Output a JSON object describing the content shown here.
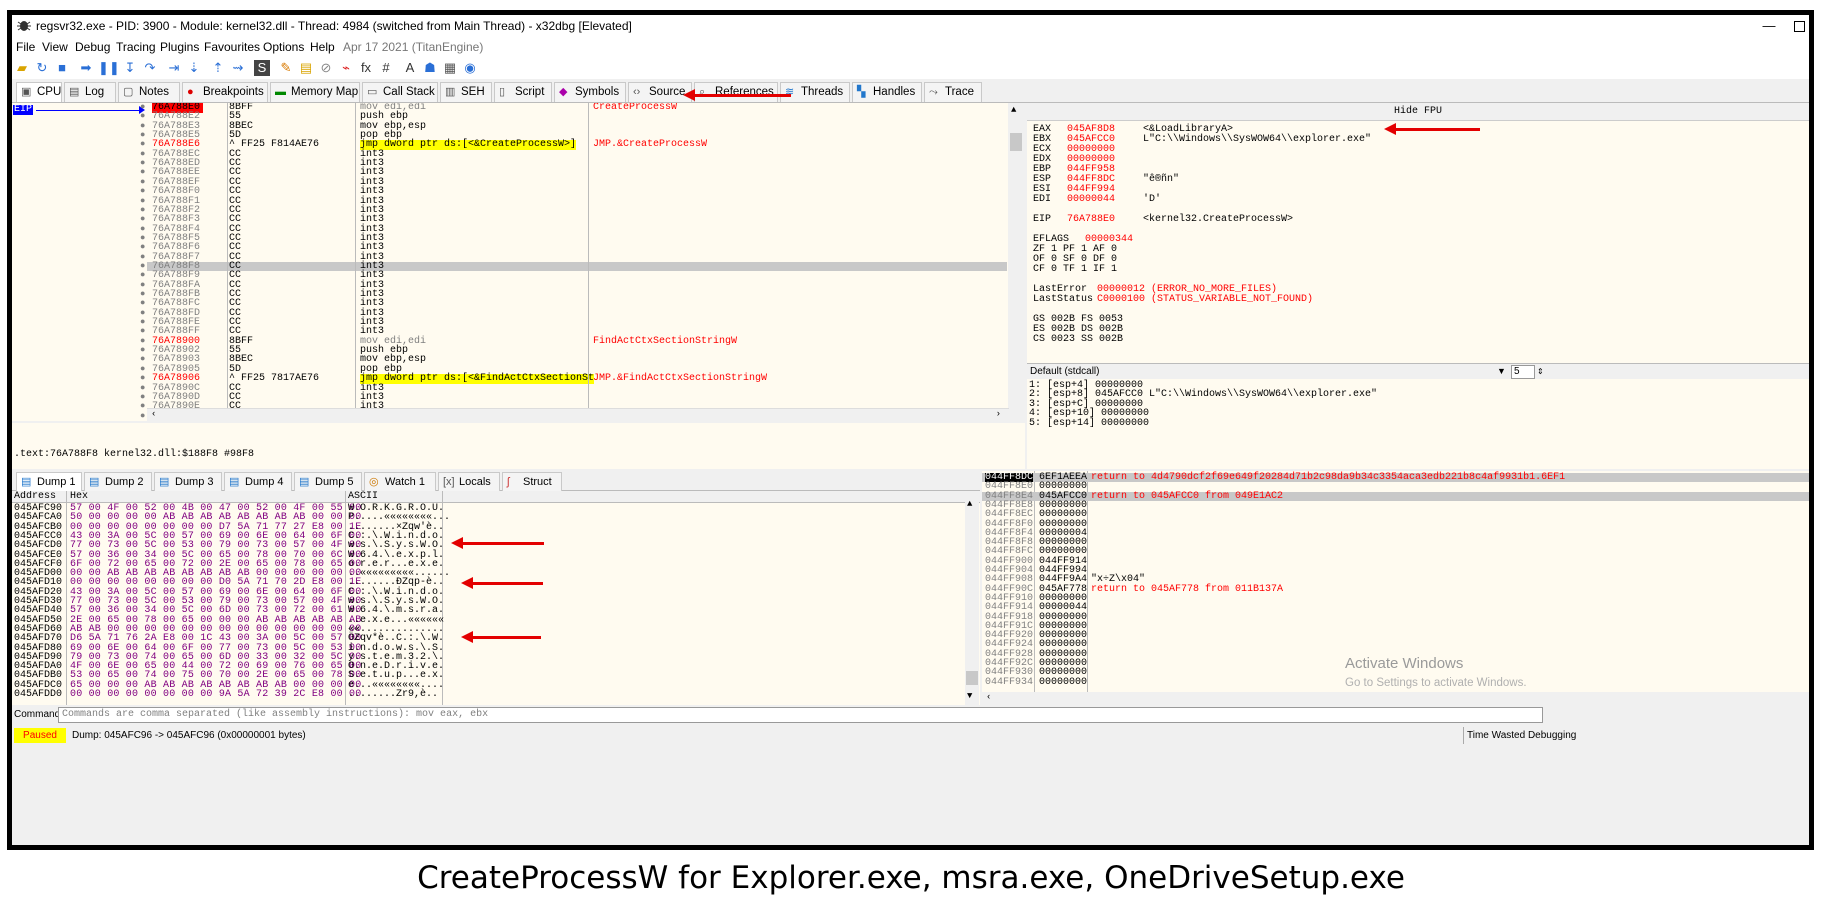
{
  "window": {
    "title": "regsvr32.exe - PID: 3900 - Module: kernel32.dll - Thread: 4984 (switched from Main Thread) - x32dbg [Elevated]",
    "minimize": "—"
  },
  "menu": [
    "File",
    "View",
    "Debug",
    "Tracing",
    "Plugins",
    "Favourites",
    "Options",
    "Help"
  ],
  "build_date": "Apr 17 2021 (TitanEngine)",
  "tabs": [
    "CPU",
    "Log",
    "Notes",
    "Breakpoints",
    "Memory Map",
    "Call Stack",
    "SEH",
    "Script",
    "Symbols",
    "Source",
    "References",
    "Threads",
    "Handles",
    "Trace"
  ],
  "disasm": {
    "eip_label": "EIP",
    "rows": [
      {
        "addr": "76A788E0",
        "bytes": "8BFF",
        "dis": "mov edi,edi",
        "cmt": "CreateProcessW",
        "addr_style": "hl",
        "dis_style": "gray"
      },
      {
        "addr": "76A788E2",
        "bytes": "55",
        "dis": "push ebp",
        "cmt": ""
      },
      {
        "addr": "76A788E3",
        "bytes": "8BEC",
        "dis": "mov ebp,esp",
        "cmt": ""
      },
      {
        "addr": "76A788E5",
        "bytes": "5D",
        "dis": "pop ebp",
        "cmt": ""
      },
      {
        "addr": "76A788E6",
        "bytes": "^ FF25 F814AE76",
        "dis": "jmp dword ptr ds:[<&CreateProcessW>]",
        "cmt": "JMP.&CreateProcessW",
        "addr_style": "red"
      },
      {
        "addr": "76A788EC",
        "bytes": "CC",
        "dis": "int3",
        "cmt": ""
      },
      {
        "addr": "76A788ED",
        "bytes": "CC",
        "dis": "int3",
        "cmt": ""
      },
      {
        "addr": "76A788EE",
        "bytes": "CC",
        "dis": "int3",
        "cmt": ""
      },
      {
        "addr": "76A788EF",
        "bytes": "CC",
        "dis": "int3",
        "cmt": ""
      },
      {
        "addr": "76A788F0",
        "bytes": "CC",
        "dis": "int3",
        "cmt": ""
      },
      {
        "addr": "76A788F1",
        "bytes": "CC",
        "dis": "int3",
        "cmt": ""
      },
      {
        "addr": "76A788F2",
        "bytes": "CC",
        "dis": "int3",
        "cmt": ""
      },
      {
        "addr": "76A788F3",
        "bytes": "CC",
        "dis": "int3",
        "cmt": ""
      },
      {
        "addr": "76A788F4",
        "bytes": "CC",
        "dis": "int3",
        "cmt": ""
      },
      {
        "addr": "76A788F5",
        "bytes": "CC",
        "dis": "int3",
        "cmt": ""
      },
      {
        "addr": "76A788F6",
        "bytes": "CC",
        "dis": "int3",
        "cmt": ""
      },
      {
        "addr": "76A788F7",
        "bytes": "CC",
        "dis": "int3",
        "cmt": ""
      },
      {
        "addr": "76A788F8",
        "bytes": "CC",
        "dis": "int3",
        "cmt": "",
        "sel": true
      },
      {
        "addr": "76A788F9",
        "bytes": "CC",
        "dis": "int3",
        "cmt": ""
      },
      {
        "addr": "76A788FA",
        "bytes": "CC",
        "dis": "int3",
        "cmt": ""
      },
      {
        "addr": "76A788FB",
        "bytes": "CC",
        "dis": "int3",
        "cmt": ""
      },
      {
        "addr": "76A788FC",
        "bytes": "CC",
        "dis": "int3",
        "cmt": ""
      },
      {
        "addr": "76A788FD",
        "bytes": "CC",
        "dis": "int3",
        "cmt": ""
      },
      {
        "addr": "76A788FE",
        "bytes": "CC",
        "dis": "int3",
        "cmt": ""
      },
      {
        "addr": "76A788FF",
        "bytes": "CC",
        "dis": "int3",
        "cmt": ""
      },
      {
        "addr": "76A78900",
        "bytes": "8BFF",
        "dis": "mov edi,edi",
        "cmt": "FindActCtxSectionStringW",
        "addr_style": "red",
        "dis_style": "gray"
      },
      {
        "addr": "76A78902",
        "bytes": "55",
        "dis": "push ebp",
        "cmt": ""
      },
      {
        "addr": "76A78903",
        "bytes": "8BEC",
        "dis": "mov ebp,esp",
        "cmt": ""
      },
      {
        "addr": "76A78905",
        "bytes": "5D",
        "dis": "pop ebp",
        "cmt": ""
      },
      {
        "addr": "76A78906",
        "bytes": "^ FF25 7817AE76",
        "dis": "jmp dword ptr ds:[<&FindActCtxSectionSt",
        "cmt": "JMP.&FindActCtxSectionStringW",
        "addr_style": "red"
      },
      {
        "addr": "76A7890C",
        "bytes": "CC",
        "dis": "int3",
        "cmt": ""
      },
      {
        "addr": "76A7890D",
        "bytes": "CC",
        "dis": "int3",
        "cmt": ""
      },
      {
        "addr": "76A7890E",
        "bytes": "CC",
        "dis": "int3",
        "cmt": ""
      },
      {
        "addr": "76A7890F",
        "bytes": "CC",
        "dis": "int3",
        "cmt": ""
      }
    ]
  },
  "info_line": ".text:76A788F8 kernel32.dll:$188F8 #98F8",
  "registers": {
    "hide_fpu": "Hide FPU",
    "regs": [
      {
        "n": "EAX",
        "v": "045AF8D8",
        "c": "<&LoadLibraryA>"
      },
      {
        "n": "EBX",
        "v": "045AFCC0",
        "c": "L\"C:\\\\Windows\\\\SysWOW64\\\\explorer.exe\""
      },
      {
        "n": "ECX",
        "v": "00000000",
        "c": ""
      },
      {
        "n": "EDX",
        "v": "00000000",
        "c": ""
      },
      {
        "n": "EBP",
        "v": "044FF958",
        "c": ""
      },
      {
        "n": "ESP",
        "v": "044FF8DC",
        "c": "\"ê®ñn\""
      },
      {
        "n": "ESI",
        "v": "044FF994",
        "c": ""
      },
      {
        "n": "EDI",
        "v": "00000044",
        "c": "'D'"
      }
    ],
    "eip": {
      "n": "EIP",
      "v": "76A788E0",
      "c": "<kernel32.CreateProcessW>"
    },
    "eflags": {
      "n": "EFLAGS",
      "v": "00000344"
    },
    "flag_rows": [
      "ZF 1  PF 1  AF 0",
      "OF 0  SF 0  DF 0",
      "CF 0  TF 1  IF 1"
    ],
    "lasterror": {
      "n": "LastError",
      "v": "00000012",
      "c": "(ERROR_NO_MORE_FILES)"
    },
    "laststatus": {
      "n": "LastStatus",
      "v": "C0000100",
      "c": "(STATUS_VARIABLE_NOT_FOUND)"
    },
    "seg_rows": [
      "GS 002B  FS 0053",
      "ES 002B  DS 002B",
      "CS 0023  SS 002B"
    ]
  },
  "callconv": {
    "label": "Default (stdcall)",
    "count": "5"
  },
  "stack_args": [
    "1: [esp+4] 00000000",
    "2: [esp+8] 045AFCC0 L\"C:\\\\Windows\\\\SysWOW64\\\\explorer.exe\"",
    "3: [esp+C] 00000000",
    "4: [esp+10] 00000000",
    "5: [esp+14] 00000000"
  ],
  "dump_tabs": [
    "Dump 1",
    "Dump 2",
    "Dump 3",
    "Dump 4",
    "Dump 5",
    "Watch 1",
    "Locals",
    "Struct"
  ],
  "dump_headers": {
    "address": "Address",
    "hex": "Hex",
    "ascii": "ASCII"
  },
  "dump_rows": [
    {
      "a": "045AFC90",
      "h": "57 00 4F 00 52 00 4B 00 47 00 52 00 4F 00 55 00",
      "s": "W.O.R.K.G.R.O.U."
    },
    {
      "a": "045AFCA0",
      "h": "50 00 00 00 00 AB AB AB AB AB AB AB AB 00 00 00",
      "s": "P.....««««««««..."
    },
    {
      "a": "045AFCB0",
      "h": "00 00 00 00 00 00 00 00 D7 5A 71 77 27 E8 00 1E",
      "s": "........×Zqw'è.."
    },
    {
      "a": "045AFCC0",
      "h": "43 00 3A 00 5C 00 57 00 69 00 6E 00 64 00 6F 00",
      "s": "C.:.\\.W.i.n.d.o."
    },
    {
      "a": "045AFCD0",
      "h": "77 00 73 00 5C 00 53 00 79 00 73 00 57 00 4F 00",
      "s": "w.s.\\.S.y.s.W.O."
    },
    {
      "a": "045AFCE0",
      "h": "57 00 36 00 34 00 5C 00 65 00 78 00 70 00 6C 00",
      "s": "W.6.4.\\.e.x.p.l."
    },
    {
      "a": "045AFCF0",
      "h": "6F 00 72 00 65 00 72 00 2E 00 65 00 78 00 65 00",
      "s": "o.r.e.r...e.x.e."
    },
    {
      "a": "045AFD00",
      "h": "00 00 AB AB AB AB AB AB AB AB 00 00 00 00 00 00",
      "s": "..«««««««««......"
    },
    {
      "a": "045AFD10",
      "h": "00 00 00 00 00 00 00 00 D0 5A 71 70 2D E8 00 1E",
      "s": "........ÐZqp-è.."
    },
    {
      "a": "045AFD20",
      "h": "43 00 3A 00 5C 00 57 00 69 00 6E 00 64 00 6F 00",
      "s": "C.:.\\.W.i.n.d.o."
    },
    {
      "a": "045AFD30",
      "h": "77 00 73 00 5C 00 53 00 79 00 73 00 57 00 4F 00",
      "s": "w.s.\\.S.y.s.W.O."
    },
    {
      "a": "045AFD40",
      "h": "57 00 36 00 34 00 5C 00 6D 00 73 00 72 00 61 00",
      "s": "W.6.4.\\.m.s.r.a."
    },
    {
      "a": "045AFD50",
      "h": "2E 00 65 00 78 00 65 00 00 00 AB AB AB AB AB AB",
      "s": "..e.x.e...««««««"
    },
    {
      "a": "045AFD60",
      "h": "AB AB 00 00 00 00 00 00 00 00 00 00 00 00 00 00",
      "s": "««.............."
    },
    {
      "a": "045AFD70",
      "h": "D6 5A 71 76 2A E8 00 1C 43 00 3A 00 5C 00 57 00",
      "s": "ÖZqv*è..C.:.\\.W."
    },
    {
      "a": "045AFD80",
      "h": "69 00 6E 00 64 00 6F 00 77 00 73 00 5C 00 53 00",
      "s": "i.n.d.o.w.s.\\.S."
    },
    {
      "a": "045AFD90",
      "h": "79 00 73 00 74 00 65 00 6D 00 33 00 32 00 5C 00",
      "s": "y.s.t.e.m.3.2.\\."
    },
    {
      "a": "045AFDA0",
      "h": "4F 00 6E 00 65 00 44 00 72 00 69 00 76 00 65 00",
      "s": "O.n.e.D.r.i.v.e."
    },
    {
      "a": "045AFDB0",
      "h": "53 00 65 00 74 00 75 00 70 00 2E 00 65 00 78 00",
      "s": "S.e.t.u.p...e.x."
    },
    {
      "a": "045AFDC0",
      "h": "65 00 00 00 AB AB AB AB AB AB AB AB 00 00 00 00",
      "s": "e...««««««««...."
    },
    {
      "a": "045AFDD0",
      "h": "00 00 00 00 00 00 00 00 9A 5A 72 39 2C E8 00 00",
      "s": "........Zr9,è.."
    }
  ],
  "stack": [
    {
      "a": "044FF8DC",
      "v": "6EF1AEEA",
      "c": "return to 4d4790dcf2f69e649f20284d71b2c98da9b34c3354aca3edb221b8c4af9931b1.6EF1",
      "sel": true
    },
    {
      "a": "044FF8E0",
      "v": "00000000",
      "c": ""
    },
    {
      "a": "044FF8E4",
      "v": "045AFCC0",
      "c": "return to 045AFCC0 from 049E1AC2",
      "sel": true
    },
    {
      "a": "044FF8E8",
      "v": "00000000",
      "c": ""
    },
    {
      "a": "044FF8EC",
      "v": "00000000",
      "c": ""
    },
    {
      "a": "044FF8F0",
      "v": "00000000",
      "c": ""
    },
    {
      "a": "044FF8F4",
      "v": "00000004",
      "c": ""
    },
    {
      "a": "044FF8F8",
      "v": "00000000",
      "c": ""
    },
    {
      "a": "044FF8FC",
      "v": "00000000",
      "c": ""
    },
    {
      "a": "044FF900",
      "v": "044FF914",
      "c": ""
    },
    {
      "a": "044FF904",
      "v": "044FF994",
      "c": ""
    },
    {
      "a": "044FF908",
      "v": "044FF9A4",
      "c": "\"x÷Z\\x04\"",
      "black": true
    },
    {
      "a": "044FF90C",
      "v": "045AF778",
      "c": "return to 045AF778 from 011B137A"
    },
    {
      "a": "044FF910",
      "v": "00000000",
      "c": ""
    },
    {
      "a": "044FF914",
      "v": "00000044",
      "c": ""
    },
    {
      "a": "044FF918",
      "v": "00000000",
      "c": ""
    },
    {
      "a": "044FF91C",
      "v": "00000000",
      "c": ""
    },
    {
      "a": "044FF920",
      "v": "00000000",
      "c": ""
    },
    {
      "a": "044FF924",
      "v": "00000000",
      "c": ""
    },
    {
      "a": "044FF928",
      "v": "00000000",
      "c": ""
    },
    {
      "a": "044FF92C",
      "v": "00000000",
      "c": ""
    },
    {
      "a": "044FF930",
      "v": "00000000",
      "c": ""
    },
    {
      "a": "044FF934",
      "v": "00000000",
      "c": ""
    }
  ],
  "activate": {
    "line1": "Activate Windows",
    "line2": "Go to Settings to activate Windows."
  },
  "command": {
    "label": "Command:",
    "placeholder": "Commands are comma separated (like assembly instructions): mov eax, ebx"
  },
  "status": {
    "state": "Paused",
    "text": "Dump: 045AFC96 -> 045AFC96 (0x00000001 bytes)",
    "right": "Time Wasted Debugging"
  },
  "caption": "CreateProcessW for Explorer.exe, msra.exe, OneDriveSetup.exe",
  "colors": {
    "accent_red": "#e30000",
    "eip_blue": "#0000ff",
    "paused_yellow": "#ffff00",
    "pane_bg": "#fffbf0"
  }
}
